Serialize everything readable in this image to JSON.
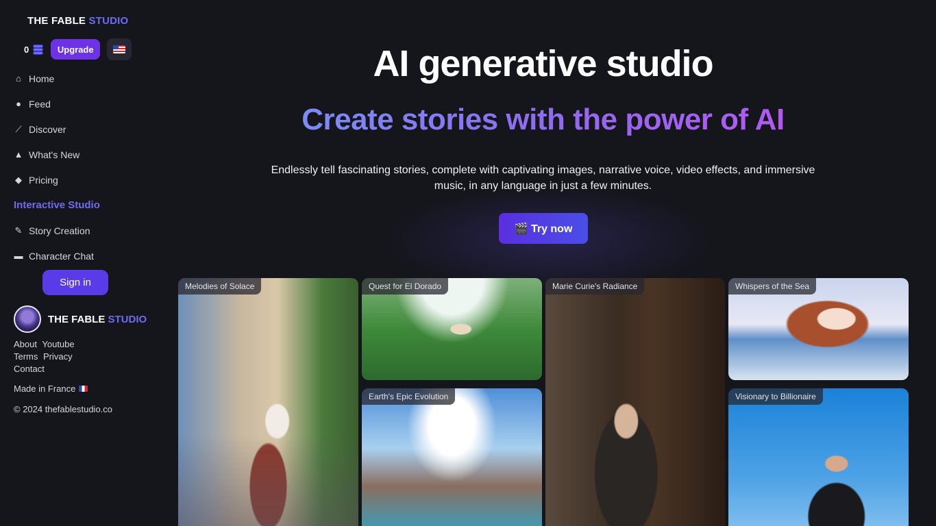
{
  "sidebar": {
    "logo": {
      "part1": "THE FABLE ",
      "part2": "STUDIO"
    },
    "credits": "0",
    "upgrade_label": "Upgrade",
    "nav": [
      {
        "label": "Home",
        "icon": "home-icon"
      },
      {
        "label": "Feed",
        "icon": "compass-icon"
      },
      {
        "label": "Discover",
        "icon": "magic-wand-icon"
      },
      {
        "label": "What's New",
        "icon": "bell-icon"
      },
      {
        "label": "Pricing",
        "icon": "tag-icon"
      }
    ],
    "section_title": "Interactive Studio",
    "studio_nav": [
      {
        "label": "Story Creation",
        "icon": "feather-icon"
      },
      {
        "label": "Character Chat",
        "icon": "chat-icon"
      }
    ],
    "signin_label": "Sign in",
    "brand": {
      "part1": "THE FABLE ",
      "part2": "STUDIO"
    },
    "footer_links": {
      "about": "About",
      "youtube": "Youtube",
      "terms": "Terms",
      "privacy": "Privacy",
      "contact": "Contact"
    },
    "made_in": "Made in France",
    "copyright": "© 2024 thefablestudio.co"
  },
  "hero": {
    "title": "AI generative studio",
    "subtitle": "Create stories with the power of AI",
    "description": "Endlessly tell fascinating stories, complete with captivating images, narrative voice, video effects, and immersive music, in any language in just a few minutes.",
    "cta_label": "🎬 Try now"
  },
  "gallery": [
    {
      "title": "Melodies of Solace"
    },
    {
      "title": "Quest for El Dorado"
    },
    {
      "title": "Earth's Epic Evolution"
    },
    {
      "title": "Marie Curie's Radiance"
    },
    {
      "title": "Whispers of the Sea"
    },
    {
      "title": "Visionary to Billionaire"
    }
  ],
  "colors": {
    "background": "#15151c",
    "accent": "#6e6cf5",
    "button": "#5a3be8"
  }
}
